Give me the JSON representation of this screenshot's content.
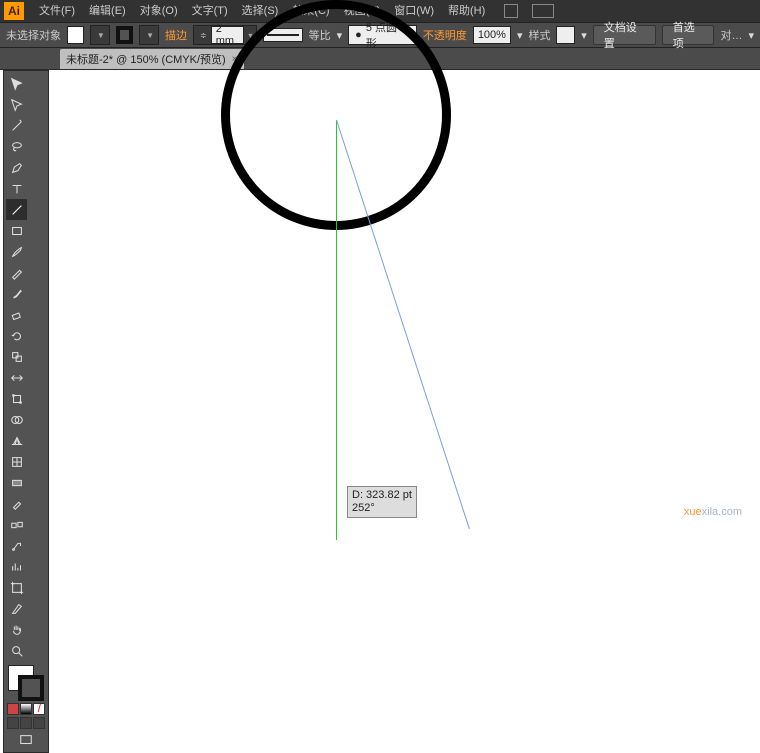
{
  "menu": {
    "items": [
      "文件(F)",
      "编辑(E)",
      "对象(O)",
      "文字(T)",
      "选择(S)",
      "效果(C)",
      "视图(V)",
      "窗口(W)",
      "帮助(H)"
    ]
  },
  "ctrl": {
    "status": "未选择对象",
    "fill": "#ffffff",
    "stroke": "#000000",
    "strokeLabel": "描边",
    "strokeWeight": "2 mm",
    "dashLabel": "等比",
    "brushLabel": "5 点圆形",
    "opacityLabel": "不透明度",
    "opacity": "100%",
    "styleLabel": "样式",
    "docSetup": "文档设置",
    "prefs": "首选项",
    "align": "对…"
  },
  "tab": {
    "title": "未标题-2* @ 150% (CMYK/预览)"
  },
  "tooltip": {
    "line1": "D: 323.82 pt",
    "line2": "252°"
  },
  "water": {
    "a": "xue",
    "b": "xila.com"
  }
}
